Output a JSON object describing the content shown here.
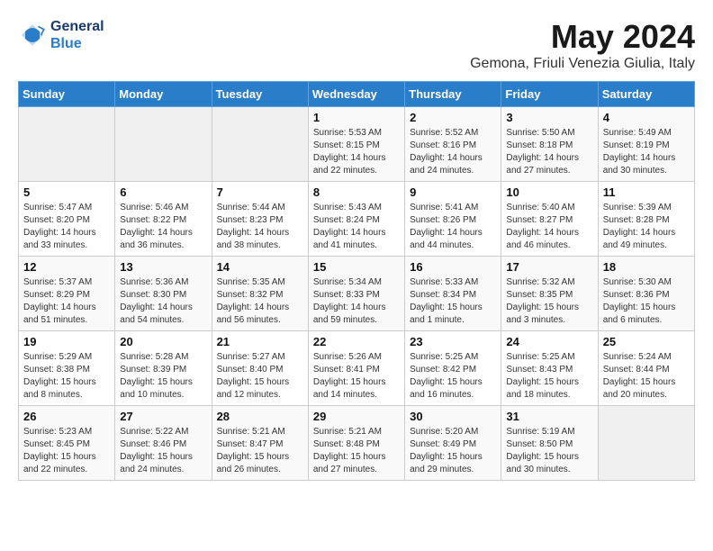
{
  "header": {
    "logo_text_general": "General",
    "logo_text_blue": "Blue",
    "month_year": "May 2024",
    "location": "Gemona, Friuli Venezia Giulia, Italy"
  },
  "days_of_week": [
    "Sunday",
    "Monday",
    "Tuesday",
    "Wednesday",
    "Thursday",
    "Friday",
    "Saturday"
  ],
  "weeks": [
    [
      {
        "day": "",
        "sunrise": "",
        "sunset": "",
        "daylight": ""
      },
      {
        "day": "",
        "sunrise": "",
        "sunset": "",
        "daylight": ""
      },
      {
        "day": "",
        "sunrise": "",
        "sunset": "",
        "daylight": ""
      },
      {
        "day": "1",
        "sunrise": "Sunrise: 5:53 AM",
        "sunset": "Sunset: 8:15 PM",
        "daylight": "Daylight: 14 hours and 22 minutes."
      },
      {
        "day": "2",
        "sunrise": "Sunrise: 5:52 AM",
        "sunset": "Sunset: 8:16 PM",
        "daylight": "Daylight: 14 hours and 24 minutes."
      },
      {
        "day": "3",
        "sunrise": "Sunrise: 5:50 AM",
        "sunset": "Sunset: 8:18 PM",
        "daylight": "Daylight: 14 hours and 27 minutes."
      },
      {
        "day": "4",
        "sunrise": "Sunrise: 5:49 AM",
        "sunset": "Sunset: 8:19 PM",
        "daylight": "Daylight: 14 hours and 30 minutes."
      }
    ],
    [
      {
        "day": "5",
        "sunrise": "Sunrise: 5:47 AM",
        "sunset": "Sunset: 8:20 PM",
        "daylight": "Daylight: 14 hours and 33 minutes."
      },
      {
        "day": "6",
        "sunrise": "Sunrise: 5:46 AM",
        "sunset": "Sunset: 8:22 PM",
        "daylight": "Daylight: 14 hours and 36 minutes."
      },
      {
        "day": "7",
        "sunrise": "Sunrise: 5:44 AM",
        "sunset": "Sunset: 8:23 PM",
        "daylight": "Daylight: 14 hours and 38 minutes."
      },
      {
        "day": "8",
        "sunrise": "Sunrise: 5:43 AM",
        "sunset": "Sunset: 8:24 PM",
        "daylight": "Daylight: 14 hours and 41 minutes."
      },
      {
        "day": "9",
        "sunrise": "Sunrise: 5:41 AM",
        "sunset": "Sunset: 8:26 PM",
        "daylight": "Daylight: 14 hours and 44 minutes."
      },
      {
        "day": "10",
        "sunrise": "Sunrise: 5:40 AM",
        "sunset": "Sunset: 8:27 PM",
        "daylight": "Daylight: 14 hours and 46 minutes."
      },
      {
        "day": "11",
        "sunrise": "Sunrise: 5:39 AM",
        "sunset": "Sunset: 8:28 PM",
        "daylight": "Daylight: 14 hours and 49 minutes."
      }
    ],
    [
      {
        "day": "12",
        "sunrise": "Sunrise: 5:37 AM",
        "sunset": "Sunset: 8:29 PM",
        "daylight": "Daylight: 14 hours and 51 minutes."
      },
      {
        "day": "13",
        "sunrise": "Sunrise: 5:36 AM",
        "sunset": "Sunset: 8:30 PM",
        "daylight": "Daylight: 14 hours and 54 minutes."
      },
      {
        "day": "14",
        "sunrise": "Sunrise: 5:35 AM",
        "sunset": "Sunset: 8:32 PM",
        "daylight": "Daylight: 14 hours and 56 minutes."
      },
      {
        "day": "15",
        "sunrise": "Sunrise: 5:34 AM",
        "sunset": "Sunset: 8:33 PM",
        "daylight": "Daylight: 14 hours and 59 minutes."
      },
      {
        "day": "16",
        "sunrise": "Sunrise: 5:33 AM",
        "sunset": "Sunset: 8:34 PM",
        "daylight": "Daylight: 15 hours and 1 minute."
      },
      {
        "day": "17",
        "sunrise": "Sunrise: 5:32 AM",
        "sunset": "Sunset: 8:35 PM",
        "daylight": "Daylight: 15 hours and 3 minutes."
      },
      {
        "day": "18",
        "sunrise": "Sunrise: 5:30 AM",
        "sunset": "Sunset: 8:36 PM",
        "daylight": "Daylight: 15 hours and 6 minutes."
      }
    ],
    [
      {
        "day": "19",
        "sunrise": "Sunrise: 5:29 AM",
        "sunset": "Sunset: 8:38 PM",
        "daylight": "Daylight: 15 hours and 8 minutes."
      },
      {
        "day": "20",
        "sunrise": "Sunrise: 5:28 AM",
        "sunset": "Sunset: 8:39 PM",
        "daylight": "Daylight: 15 hours and 10 minutes."
      },
      {
        "day": "21",
        "sunrise": "Sunrise: 5:27 AM",
        "sunset": "Sunset: 8:40 PM",
        "daylight": "Daylight: 15 hours and 12 minutes."
      },
      {
        "day": "22",
        "sunrise": "Sunrise: 5:26 AM",
        "sunset": "Sunset: 8:41 PM",
        "daylight": "Daylight: 15 hours and 14 minutes."
      },
      {
        "day": "23",
        "sunrise": "Sunrise: 5:25 AM",
        "sunset": "Sunset: 8:42 PM",
        "daylight": "Daylight: 15 hours and 16 minutes."
      },
      {
        "day": "24",
        "sunrise": "Sunrise: 5:25 AM",
        "sunset": "Sunset: 8:43 PM",
        "daylight": "Daylight: 15 hours and 18 minutes."
      },
      {
        "day": "25",
        "sunrise": "Sunrise: 5:24 AM",
        "sunset": "Sunset: 8:44 PM",
        "daylight": "Daylight: 15 hours and 20 minutes."
      }
    ],
    [
      {
        "day": "26",
        "sunrise": "Sunrise: 5:23 AM",
        "sunset": "Sunset: 8:45 PM",
        "daylight": "Daylight: 15 hours and 22 minutes."
      },
      {
        "day": "27",
        "sunrise": "Sunrise: 5:22 AM",
        "sunset": "Sunset: 8:46 PM",
        "daylight": "Daylight: 15 hours and 24 minutes."
      },
      {
        "day": "28",
        "sunrise": "Sunrise: 5:21 AM",
        "sunset": "Sunset: 8:47 PM",
        "daylight": "Daylight: 15 hours and 26 minutes."
      },
      {
        "day": "29",
        "sunrise": "Sunrise: 5:21 AM",
        "sunset": "Sunset: 8:48 PM",
        "daylight": "Daylight: 15 hours and 27 minutes."
      },
      {
        "day": "30",
        "sunrise": "Sunrise: 5:20 AM",
        "sunset": "Sunset: 8:49 PM",
        "daylight": "Daylight: 15 hours and 29 minutes."
      },
      {
        "day": "31",
        "sunrise": "Sunrise: 5:19 AM",
        "sunset": "Sunset: 8:50 PM",
        "daylight": "Daylight: 15 hours and 30 minutes."
      },
      {
        "day": "",
        "sunrise": "",
        "sunset": "",
        "daylight": ""
      }
    ]
  ]
}
